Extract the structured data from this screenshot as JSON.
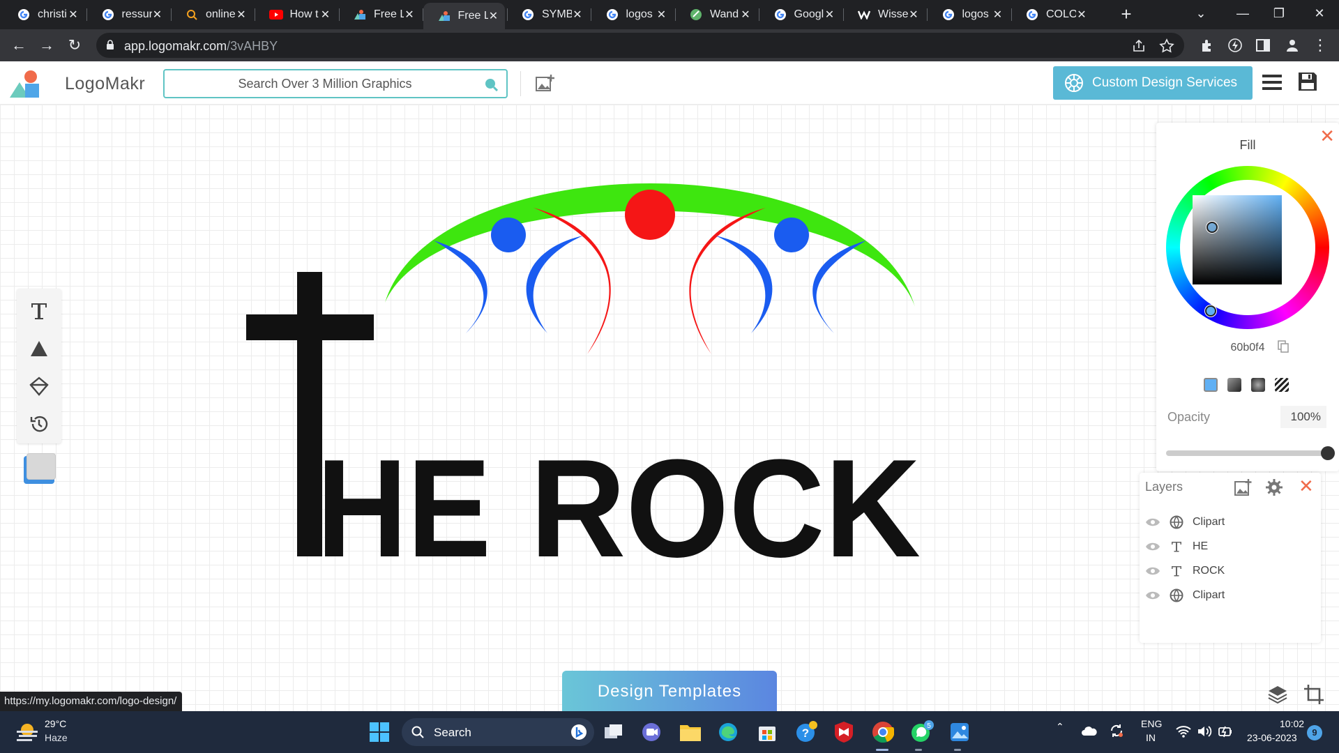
{
  "browser": {
    "tabs": [
      {
        "title": "christi",
        "favicon": "google-icon",
        "active": false
      },
      {
        "title": "ressur",
        "favicon": "google-icon",
        "active": false
      },
      {
        "title": "online",
        "favicon": "search-icon",
        "active": false
      },
      {
        "title": "How t",
        "favicon": "youtube-icon",
        "active": false
      },
      {
        "title": "Free L",
        "favicon": "logomakr-icon",
        "active": false
      },
      {
        "title": "Free L",
        "favicon": "logomakr-icon",
        "active": true
      },
      {
        "title": "SYMB",
        "favicon": "google-icon",
        "active": false
      },
      {
        "title": "logos",
        "favicon": "google-icon",
        "active": false
      },
      {
        "title": "Wand",
        "favicon": "wand-icon",
        "active": false
      },
      {
        "title": "Googl",
        "favicon": "google-icon",
        "active": false
      },
      {
        "title": "Wisse",
        "favicon": "wix-icon",
        "active": false
      },
      {
        "title": "logos",
        "favicon": "google-icon",
        "active": false
      },
      {
        "title": "COLO",
        "favicon": "google-icon",
        "active": false
      }
    ],
    "url_host": "app.logomakr.com",
    "url_path": "/3vAHBY",
    "status_url": "https://my.logomakr.com/logo-design/"
  },
  "app": {
    "logo_text": "LogoMakr",
    "search_placeholder": "Search Over 3 Million Graphics",
    "custom_design_label": "Custom Design Services",
    "design_templates_label": "Design Templates",
    "accent_color": "#5ab9d6"
  },
  "artwork": {
    "text_he": "HE",
    "text_rock": "ROCK",
    "colors": {
      "arc": "#3ee60f",
      "figure_red": "#f51616",
      "figure_blue": "#1a5cf0",
      "text": "#111111"
    }
  },
  "fill_panel": {
    "title": "Fill",
    "hex": "60b0f4",
    "opacity_label": "Opacity",
    "opacity_value": "100%",
    "opacity_fraction": 1.0
  },
  "layers": {
    "title": "Layers",
    "items": [
      {
        "name": "Clipart",
        "type": "clipart-icon"
      },
      {
        "name": "HE",
        "type": "text-icon"
      },
      {
        "name": "ROCK",
        "type": "text-icon"
      },
      {
        "name": "Clipart",
        "type": "clipart-icon"
      }
    ]
  },
  "taskbar": {
    "weather_temp": "29°C",
    "weather_desc": "Haze",
    "search_label": "Search",
    "lang_top": "ENG",
    "lang_bottom": "IN",
    "time": "10:02",
    "date": "23-06-2023",
    "notification_count": "9",
    "whatsapp_badge": "5"
  }
}
